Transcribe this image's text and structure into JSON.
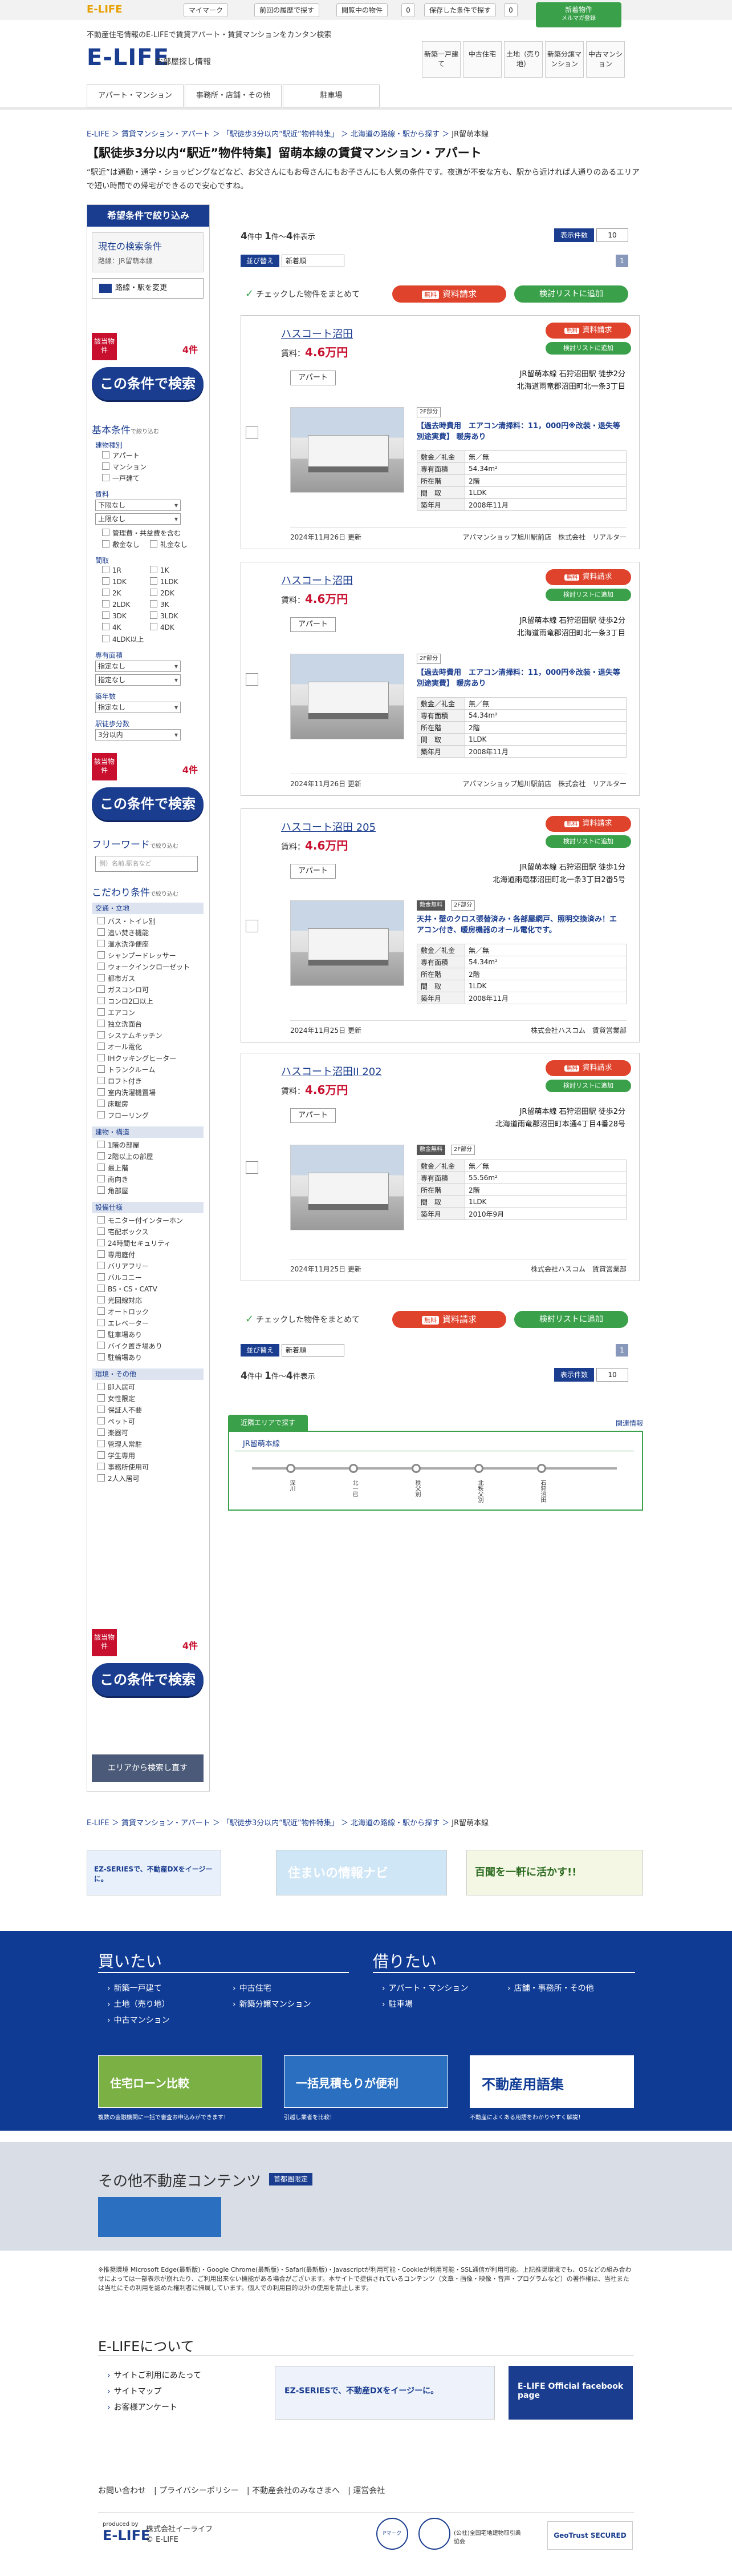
{
  "topbar": {
    "logo": "E-LIFE",
    "my_item": "マイマーク",
    "history": "前回の履歴で探す",
    "browse_count": "閲覧中の物件",
    "save": "保存した条件で探す",
    "count": "0",
    "mag_top": "無料",
    "mag_main": "新着物件",
    "mag_sub": "メルマガ登録"
  },
  "header": {
    "tagline": "不動産住宅情報のE-LIFEで賃貸アパート・賃貸マンションをカンタン検索",
    "logo": "E-LIFE",
    "sub": "お部屋探し情報",
    "nav": [
      "新築一戸建て",
      "中古住宅",
      "土地（売り地）",
      "新築分譲マンション",
      "中古マンション"
    ]
  },
  "gnav": [
    "アパート・マンション",
    "事務所・店舗・その他",
    "駐車場"
  ],
  "breadcrumb": {
    "home": "E-LIFE",
    "l1": "賃貸マンション・アパート",
    "l2": "「駅徒歩3分以内“駅近”物件特集」",
    "l3": "北海道の路線・駅から探す",
    "cur": "JR留萌本線"
  },
  "page": {
    "title": "【駅徒歩3分以内“駅近”物件特集】留萌本線の賃貸マンション・アパート",
    "desc": "“駅近”は通勤・通学・ショッピングなどなど、お父さんにもお母さんにもお子さんにも人気の条件です。夜道が不安な方も、駅から近ければ人通りのあるエリアで短い時間での帰宅ができるので安心ですね。"
  },
  "sidebar": {
    "head": "希望条件で絞り込み",
    "cur_title": "現在の検索条件",
    "cur_val": "路線：JR留萌本線",
    "reset": "路線・駅を変更",
    "count_label": "該当物件",
    "count": "4件",
    "search_btn": "この条件で検索",
    "basic_title": "基本条件",
    "basic_small": "で絞り込む",
    "kind": "建物種別",
    "kinds": [
      "アパート",
      "マンション",
      "一戸建て"
    ],
    "rent": "賃料",
    "rent_min": "下限なし",
    "rent_max": "上限なし",
    "rent_opts": [
      "管理費・共益費を含む",
      "敷金なし",
      "礼金なし"
    ],
    "layout": "間取",
    "layouts": [
      "1R",
      "1K",
      "1DK",
      "1LDK",
      "2K",
      "2DK",
      "2LDK",
      "3K",
      "3DK",
      "3LDK",
      "4K",
      "4DK",
      "4LDK以上"
    ],
    "area": "専有面積",
    "area_min": "指定なし",
    "area_max": "指定なし",
    "age": "築年数",
    "age_val": "指定なし",
    "walk": "駅徒歩分数",
    "walk_val": "3分以内",
    "free_title": "フリーワード",
    "free_small": "で絞り込む",
    "free_ph": "例）名前,駅名など",
    "kodawari": "こだわり条件",
    "kodawari_small": "で絞り込む",
    "sec_traffic": "交通・立地",
    "traffic": [
      "バス・トイレ別",
      "追い焚き機能",
      "温水洗浄便座",
      "シャンプードレッサー",
      "ウォークインクローゼット",
      "都市ガス",
      "ガスコンロ可",
      "コンロ2口以上",
      "エアコン",
      "独立洗面台",
      "システムキッチン",
      "オール電化",
      "IHクッキングヒーター",
      "トランクルーム",
      "ロフト付き",
      "室内洗濯機置場",
      "床暖房",
      "フローリング"
    ],
    "sec_build": "建物・構造",
    "build": [
      "1階の部屋",
      "2階以上の部屋",
      "最上階",
      "南向き",
      "角部屋"
    ],
    "sec_equip": "設備仕様",
    "equip": [
      "モニター付インターホン",
      "宅配ボックス",
      "24時間セキュリティ",
      "専用庭付",
      "バリアフリー",
      "バルコニー",
      "BS・CS・CATV",
      "光回線対応",
      "オートロック",
      "エレベーター",
      "駐車場あり",
      "バイク置き場あり",
      "駐輪場あり"
    ],
    "sec_other": "環境・その他",
    "other": [
      "即入居可",
      "女性限定",
      "保証人不要",
      "ペット可",
      "楽器可",
      "管理人常駐",
      "学生専用",
      "事務所使用可",
      "2人入居可"
    ],
    "area_btn": "エリアから検索し直す"
  },
  "results": {
    "total": "4",
    "from": "1",
    "to": "4",
    "unit": "件表示",
    "of": "件中",
    "disp": "表示件数",
    "disp_val": "10",
    "sort": "並び替え",
    "sort_val": "新着順",
    "bulk": "チェックした物件をまとめて",
    "req_small": "無料",
    "req": "資料請求",
    "add": "検討リストに追加",
    "page": "1"
  },
  "cards": [
    {
      "name": "ハスコート沼田",
      "price_label": "賃料：",
      "price": "4.6万円",
      "type": "アパート",
      "access": "JR留萌本線 石狩沼田駅 徒歩2分",
      "addr": "北海道雨竜郡沼田町北一条3丁目",
      "tags": [
        "2F部分"
      ],
      "note": "【過去時費用　エアコン清掃料：11，000円※改装・退失等別途実費】 暖房あり",
      "spec": [
        [
          "敷金／礼金",
          "無／無"
        ],
        [
          "専有面積",
          "54.34m²"
        ],
        [
          "所在階",
          "2階"
        ],
        [
          "間　取",
          "1LDK"
        ],
        [
          "築年月",
          "2008年11月"
        ]
      ],
      "date": "2024年11月26日 更新",
      "agent": "アパマンショップ旭川駅前店　株式会社　リアルター"
    },
    {
      "name": "ハスコート沼田",
      "price_label": "賃料：",
      "price": "4.6万円",
      "type": "アパート",
      "access": "JR留萌本線 石狩沼田駅 徒歩2分",
      "addr": "北海道雨竜郡沼田町北一条3丁目",
      "tags": [
        "2F部分"
      ],
      "note": "【過去時費用　エアコン清掃料：11，000円※改装・退失等別途実費】 暖房あり",
      "spec": [
        [
          "敷金／礼金",
          "無／無"
        ],
        [
          "専有面積",
          "54.34m²"
        ],
        [
          "所在階",
          "2階"
        ],
        [
          "間　取",
          "1LDK"
        ],
        [
          "築年月",
          "2008年11月"
        ]
      ],
      "date": "2024年11月26日 更新",
      "agent": "アパマンショップ旭川駅前店　株式会社　リアルター"
    },
    {
      "name": "ハスコート沼田 205",
      "price_label": "賃料：",
      "price": "4.6万円",
      "type": "アパート",
      "access": "JR留萌本線 石狩沼田駅 徒歩1分",
      "addr": "北海道雨竜郡沼田町北一条3丁目2番5号",
      "tags": [
        "敷金無料",
        "2F部分"
      ],
      "note": "天井・壁のクロス張替済み・各部屋網戸、照明交換済み！エアコン付き、暖房機器のオール電化です。",
      "spec": [
        [
          "敷金／礼金",
          "無／無"
        ],
        [
          "専有面積",
          "54.34m²"
        ],
        [
          "所在階",
          "2階"
        ],
        [
          "間　取",
          "1LDK"
        ],
        [
          "築年月",
          "2008年11月"
        ]
      ],
      "date": "2024年11月25日 更新",
      "agent": "株式会社ハスコム　賃貸営業部"
    },
    {
      "name": "ハスコート沼田II 202",
      "price_label": "賃料：",
      "price": "4.6万円",
      "type": "アパート",
      "access": "JR留萌本線 石狩沼田駅 徒歩2分",
      "addr": "北海道雨竜郡沼田町本通4丁目4番28号",
      "tags": [
        "敷金無料",
        "2F部分"
      ],
      "note": "",
      "spec": [
        [
          "敷金／礼金",
          "無／無"
        ],
        [
          "専有面積",
          "55.56m²"
        ],
        [
          "所在階",
          "2階"
        ],
        [
          "間　取",
          "1LDK"
        ],
        [
          "築年月",
          "2010年9月"
        ]
      ],
      "date": "2024年11月25日 更新",
      "agent": "株式会社ハスコム　賃貸営業部"
    }
  ],
  "related": {
    "tab": "近隣エリアで探す",
    "link": "関連情報",
    "title": "JR留萌本線",
    "stations": [
      "深川",
      "北一已",
      "秩父別",
      "北秩父別",
      "石狩沼田"
    ]
  },
  "banners": [
    "EZ-SERIESで、不動産DXをイージーに。",
    "住まいの情報ナビ",
    "百聞を一軒に活かす!!"
  ],
  "footer": {
    "buy": "買いたい",
    "rent": "借りたい",
    "buy_links": [
      "新築一戸建て",
      "中古住宅",
      "土地（売り地）",
      "新築分譲マンション",
      "中古マンション"
    ],
    "rent_links": [
      "アパート・マンション",
      "店舗・事務所・その他",
      "駐車場"
    ],
    "promo": [
      "住宅ローン比較",
      "一括見積もりが便利",
      "不動産用語集"
    ],
    "promo_cap": [
      "複数の金融機関に一括で審査お申込みができます！",
      "引越し業者を比較！",
      "不動産によくある用語をわかりやすく解説！"
    ],
    "other": "その他不動産コンテンツ",
    "other_badge": "首都圏限定",
    "notes": "※推奨環境 Microsoft Edge(最新版)・Google Chrome(最新版)・Safari(最新版)・Javascriptが利用可能・Cookieが利用可能・SSL通信が利用可能。上記推奨環境でも、OSなどの組み合わせによっては一部表示が崩れたり、ご利用出来ない機能がある場合がございます。本サイトで提供されているコンテンツ（文章・画像・映像・音声・プログラムなど）の著作権は、当社または当社にその利用を認めた権利者に帰属しています。個人での利用目的以外の使用を禁止します。",
    "about": "E-LIFEについて",
    "about_links": [
      "サイトご利用にあたって",
      "サイトマップ",
      "お客様アンケート"
    ],
    "fb": "E-LIFE Official facebook page",
    "links": [
      "お問い合わせ",
      "プライバシーポリシー",
      "不動産会社のみなさまへ",
      "運営会社"
    ],
    "brand": "E-LIFE",
    "produced": "produced by",
    "company": "株式会社イーライフ",
    "copyright": "© E-LIFE",
    "seals": [
      "Pマーク",
      "(公社)全国宅地建物取引業協会",
      "GeoTrust SECURED"
    ]
  }
}
